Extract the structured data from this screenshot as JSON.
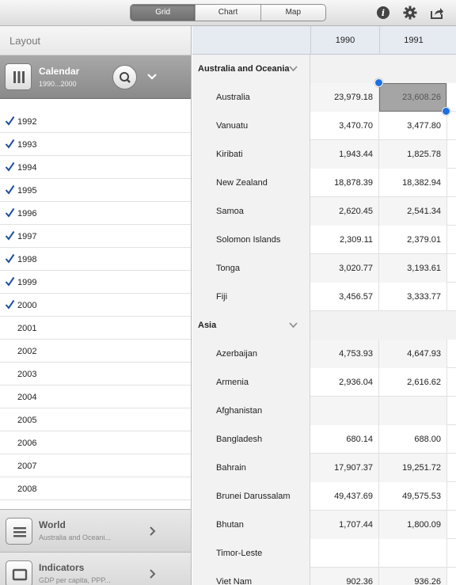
{
  "toolbar": {
    "tabs": [
      {
        "label": "Grid",
        "active": true
      },
      {
        "label": "Chart",
        "active": false
      },
      {
        "label": "Map",
        "active": false
      }
    ],
    "icons": [
      "info-icon",
      "gear-icon",
      "share-icon"
    ]
  },
  "left_panel": {
    "title": "Layout",
    "dimension": {
      "title": "Calendar",
      "subtitle": "1990...2000"
    },
    "items": [
      {
        "label": "1992",
        "checked": true
      },
      {
        "label": "1993",
        "checked": true
      },
      {
        "label": "1994",
        "checked": true
      },
      {
        "label": "1995",
        "checked": true
      },
      {
        "label": "1996",
        "checked": true
      },
      {
        "label": "1997",
        "checked": true
      },
      {
        "label": "1998",
        "checked": true
      },
      {
        "label": "1999",
        "checked": true
      },
      {
        "label": "2000",
        "checked": true
      },
      {
        "label": "2001",
        "checked": false
      },
      {
        "label": "2002",
        "checked": false
      },
      {
        "label": "2003",
        "checked": false
      },
      {
        "label": "2004",
        "checked": false
      },
      {
        "label": "2005",
        "checked": false
      },
      {
        "label": "2006",
        "checked": false
      },
      {
        "label": "2007",
        "checked": false
      },
      {
        "label": "2008",
        "checked": false
      }
    ],
    "world": {
      "title": "World",
      "subtitle": "Australia and Oceani..."
    },
    "indicators": {
      "title": "Indicators",
      "subtitle": "GDP per capita, PPP..."
    }
  },
  "grid": {
    "columns": [
      "1990",
      "1991"
    ],
    "rows": [
      {
        "type": "group",
        "name": "Australia and Oceania"
      },
      {
        "type": "row",
        "name": "Australia",
        "values": [
          "23,979.18",
          "23,608.26"
        ]
      },
      {
        "type": "row",
        "name": "Vanuatu",
        "values": [
          "3,470.70",
          "3,477.80"
        ]
      },
      {
        "type": "row",
        "name": "Kiribati",
        "values": [
          "1,943.44",
          "1,825.78"
        ]
      },
      {
        "type": "row",
        "name": "New Zealand",
        "values": [
          "18,878.39",
          "18,382.94"
        ]
      },
      {
        "type": "row",
        "name": "Samoa",
        "values": [
          "2,620.45",
          "2,541.34"
        ]
      },
      {
        "type": "row",
        "name": "Solomon Islands",
        "values": [
          "2,309.11",
          "2,379.01"
        ]
      },
      {
        "type": "row",
        "name": "Tonga",
        "values": [
          "3,020.77",
          "3,193.61"
        ]
      },
      {
        "type": "row",
        "name": "Fiji",
        "values": [
          "3,456.57",
          "3,333.77"
        ]
      },
      {
        "type": "group",
        "name": "Asia"
      },
      {
        "type": "row",
        "name": "Azerbaijan",
        "values": [
          "4,753.93",
          "4,647.93"
        ]
      },
      {
        "type": "row",
        "name": "Armenia",
        "values": [
          "2,936.04",
          "2,616.62"
        ]
      },
      {
        "type": "row",
        "name": "Afghanistan",
        "values": [
          "",
          ""
        ]
      },
      {
        "type": "row",
        "name": "Bangladesh",
        "values": [
          "680.14",
          "688.00"
        ]
      },
      {
        "type": "row",
        "name": "Bahrain",
        "values": [
          "17,907.37",
          "19,251.72"
        ]
      },
      {
        "type": "row",
        "name": "Brunei Darussalam",
        "values": [
          "49,437.69",
          "49,575.53"
        ]
      },
      {
        "type": "row",
        "name": "Bhutan",
        "values": [
          "1,707.44",
          "1,800.09"
        ]
      },
      {
        "type": "row",
        "name": "Timor-Leste",
        "values": [
          "",
          ""
        ]
      },
      {
        "type": "row",
        "name": "Viet Nam",
        "values": [
          "902.36",
          "936.26"
        ]
      }
    ],
    "selected_value": "23,608.26"
  }
}
